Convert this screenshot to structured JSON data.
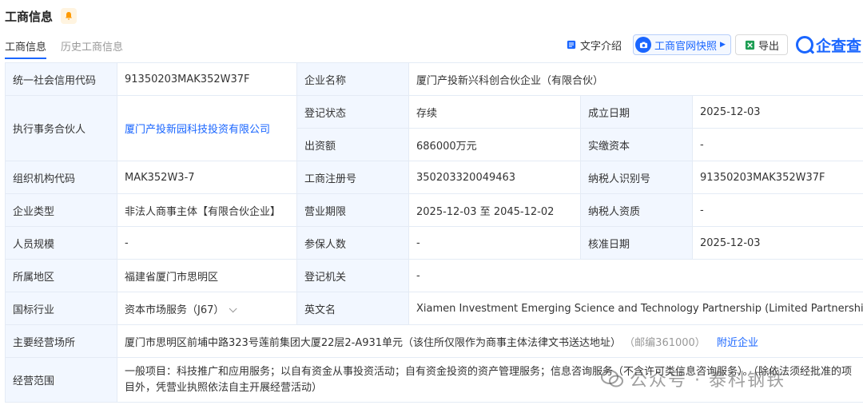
{
  "header": {
    "title": "工商信息"
  },
  "tabs": [
    {
      "label": "工商信息",
      "active": true
    },
    {
      "label": "历史工商信息",
      "active": false
    }
  ],
  "toolbar": {
    "intro_label": "文字介绍",
    "snapshot_label": "工商官网快照",
    "export_label": "导出",
    "brand": "企查查"
  },
  "rows": {
    "credit_code_label": "统一社会信用代码",
    "credit_code": "91350203MAK352W37F",
    "company_name_label": "企业名称",
    "company_name": "厦门产投新兴科创合伙企业（有限合伙）",
    "partner_label": "执行事务合伙人",
    "partner": "厦门产投新园科技投资有限公司",
    "reg_status_label": "登记状态",
    "reg_status": "存续",
    "est_date_label": "成立日期",
    "est_date": "2025-12-03",
    "capital_label": "出资额",
    "capital": "686000万元",
    "paid_capital_label": "实缴资本",
    "paid_capital": "-",
    "org_code_label": "组织机构代码",
    "org_code": "MAK352W3-7",
    "reg_no_label": "工商注册号",
    "reg_no": "350203320049463",
    "taxpayer_id_label": "纳税人识别号",
    "taxpayer_id": "91350203MAK352W37F",
    "type_label": "企业类型",
    "type": "非法人商事主体【有限合伙企业】",
    "term_label": "营业期限",
    "term": "2025-12-03 至 2045-12-02",
    "tax_qual_label": "纳税人资质",
    "tax_qual": "-",
    "staff_label": "人员规模",
    "staff": "-",
    "insured_label": "参保人数",
    "insured": "-",
    "approval_label": "核准日期",
    "approval": "2025-12-03",
    "region_label": "所属地区",
    "region": "福建省厦门市思明区",
    "authority_label": "登记机关",
    "authority": "-",
    "industry_label": "国标行业",
    "industry": "资本市场服务（J67）",
    "english_label": "英文名",
    "english": "Xiamen Investment Emerging Science and Technology Partnership (Limited Partnership)",
    "address_label": "主要经营场所",
    "address": "厦门市思明区前埔中路323号莲前集团大厦22层2-A931单元（该住所仅限作为商事主体法律文书送达地址）",
    "postcode": "（邮编361000）",
    "nearby": "附近企业",
    "scope_label": "经营范围",
    "scope": "一般项目：科技推广和应用服务；以自有资金从事投资活动；自有资金投资的资产管理服务；信息咨询服务（不含许可类信息咨询服务）。（除依法须经批准的项目外，凭营业执照依法自主开展经营活动）"
  },
  "watermark": "公众号 · 泰科钢铁",
  "colors": {
    "accent": "#1a66ff",
    "label_bg": "#f2f7ff",
    "border": "#e4ebf5"
  }
}
